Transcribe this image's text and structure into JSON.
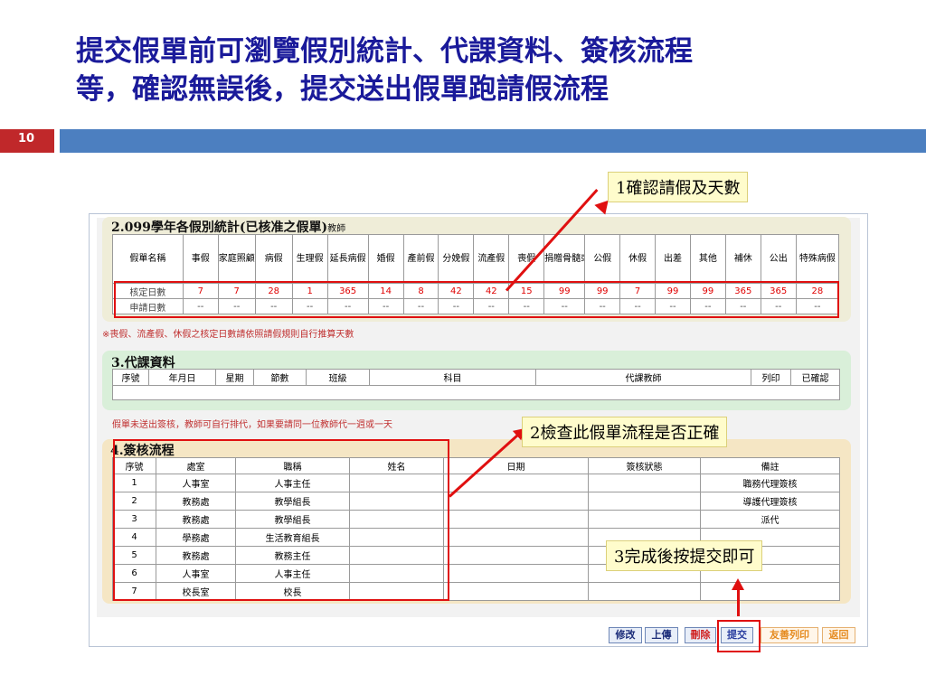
{
  "slide": {
    "title_line1": "提交假單前可瀏覽假別統計、代課資料、簽核流程",
    "title_line2": "等，確認無誤後，提交送出假單跑請假流程",
    "page_number": "10"
  },
  "stats": {
    "title": "2.099學年各假別統計(已核准之假單)",
    "title_suffix": "教師",
    "header_label": "假單名稱",
    "columns": [
      "事假",
      "家庭照顧假",
      "病假",
      "生理假",
      "延長病假",
      "婚假",
      "產前假",
      "分娩假",
      "流產假",
      "喪假",
      "捐贈骨髓或器官假",
      "公假",
      "休假",
      "出差",
      "其他",
      "補休",
      "公出",
      "特殊病假"
    ],
    "rows": [
      {
        "label": "核定日數",
        "values": [
          "7",
          "7",
          "28",
          "1",
          "365",
          "14",
          "8",
          "42",
          "42",
          "15",
          "99",
          "99",
          "7",
          "99",
          "99",
          "365",
          "365",
          "28"
        ]
      },
      {
        "label": "申請日數",
        "values": [
          "--",
          "--",
          "--",
          "--",
          "--",
          "--",
          "--",
          "--",
          "--",
          "--",
          "--",
          "--",
          "--",
          "--",
          "--",
          "--",
          "--",
          "--"
        ]
      }
    ],
    "note": "※喪假、流產假、休假之核定日數請依照請假規則自行推算天數"
  },
  "substitute": {
    "title": "3.代課資料",
    "columns": [
      "序號",
      "年月日",
      "星期",
      "節數",
      "班級",
      "科目",
      "代課教師",
      "列印",
      "已確認"
    ]
  },
  "flow_note": "假單未送出簽核，教師可自行排代，如果要請同一位教師代一週或一天",
  "flow": {
    "title": "4.簽核流程",
    "columns": [
      "序號",
      "處室",
      "職稱",
      "姓名",
      "日期",
      "簽核狀態",
      "備註"
    ],
    "rows": [
      {
        "no": "1",
        "office": "人事室",
        "role": "人事主任",
        "remark": "職務代理簽核"
      },
      {
        "no": "2",
        "office": "教務處",
        "role": "教學組長",
        "remark": "導護代理簽核"
      },
      {
        "no": "3",
        "office": "教務處",
        "role": "教學組長",
        "remark": "派代"
      },
      {
        "no": "4",
        "office": "學務處",
        "role": "生活教育組長",
        "remark": ""
      },
      {
        "no": "5",
        "office": "教務處",
        "role": "教務主任",
        "remark": ""
      },
      {
        "no": "6",
        "office": "人事室",
        "role": "人事主任",
        "remark": ""
      },
      {
        "no": "7",
        "office": "校長室",
        "role": "校長",
        "remark": ""
      }
    ]
  },
  "callouts": {
    "c1": "1確認請假及天數",
    "c2": "2檢查此假單流程是否正確",
    "c3": "3完成後按提交即可"
  },
  "buttons": {
    "edit": "修改",
    "upload": "上傳",
    "delete": "刪除",
    "submit": "提交",
    "print": "友善列印",
    "back": "返回"
  },
  "colors": {
    "title": "#1a1a9a",
    "page_bar": "#c0282a",
    "header_bar": "#4c7fc0",
    "highlight": "#e01010",
    "callout_bg": "#fffccc"
  }
}
